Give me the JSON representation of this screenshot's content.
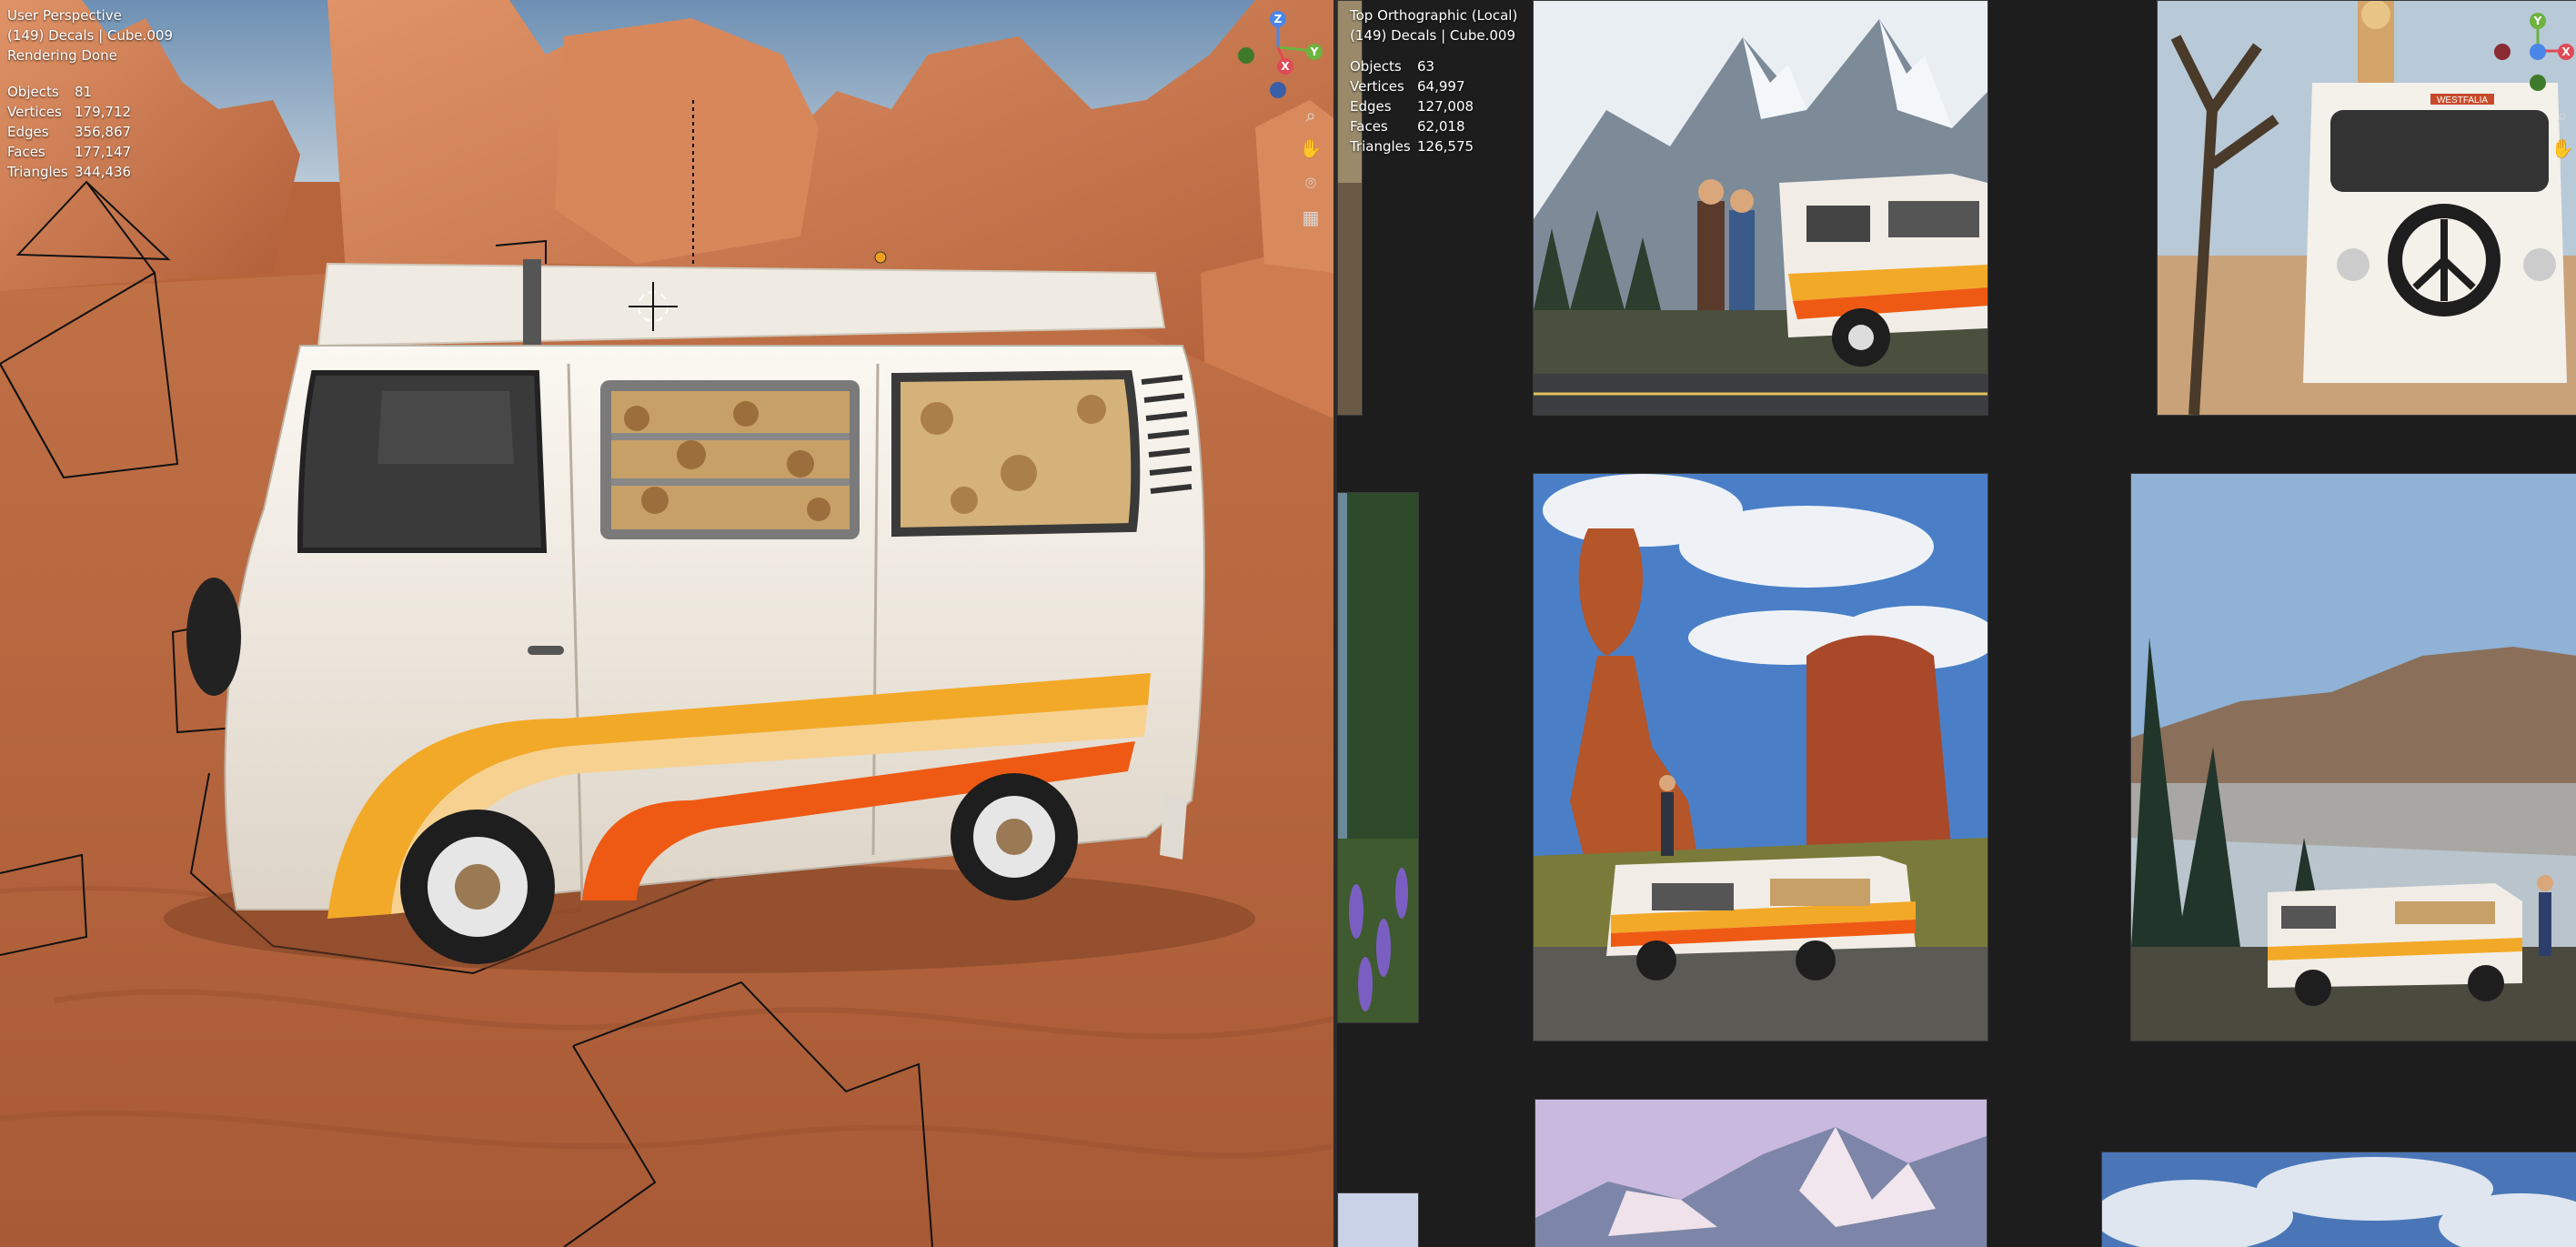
{
  "left_viewport": {
    "view_name": "User Perspective",
    "collection": "(149) Decals | Cube.009",
    "status": "Rendering Done",
    "stats": [
      {
        "label": "Objects",
        "value": "81"
      },
      {
        "label": "Vertices",
        "value": "179,712"
      },
      {
        "label": "Edges",
        "value": "356,867"
      },
      {
        "label": "Faces",
        "value": "177,147"
      },
      {
        "label": "Triangles",
        "value": "344,436"
      }
    ],
    "gizmo_axes": [
      "Z",
      "Y",
      "X"
    ]
  },
  "right_viewport": {
    "view_name": "Top Orthographic (Local)",
    "collection": "(149) Decals | Cube.009",
    "stats": [
      {
        "label": "Objects",
        "value": "63"
      },
      {
        "label": "Vertices",
        "value": "64,997"
      },
      {
        "label": "Edges",
        "value": "127,008"
      },
      {
        "label": "Faces",
        "value": "62,018"
      },
      {
        "label": "Triangles",
        "value": "126,575"
      }
    ],
    "gizmo_axes": [
      "Y",
      "X"
    ]
  },
  "nav_icons": [
    "zoom-icon",
    "hand-pan-icon",
    "camera-icon",
    "grid-icon"
  ],
  "van": {
    "badge_text": "WESTFALIA"
  },
  "colors": {
    "sand": "#b8643a",
    "rock": "#c9754a",
    "van_body": "#f1ece4",
    "stripe_orange": "#f08a14",
    "stripe_yellow": "#f3a928",
    "stripe_red": "#ee5a14",
    "panel_bg": "#1d1d1d",
    "axis_x": "#e04a55",
    "axis_y": "#6cb33f",
    "axis_z": "#4a86e8"
  }
}
